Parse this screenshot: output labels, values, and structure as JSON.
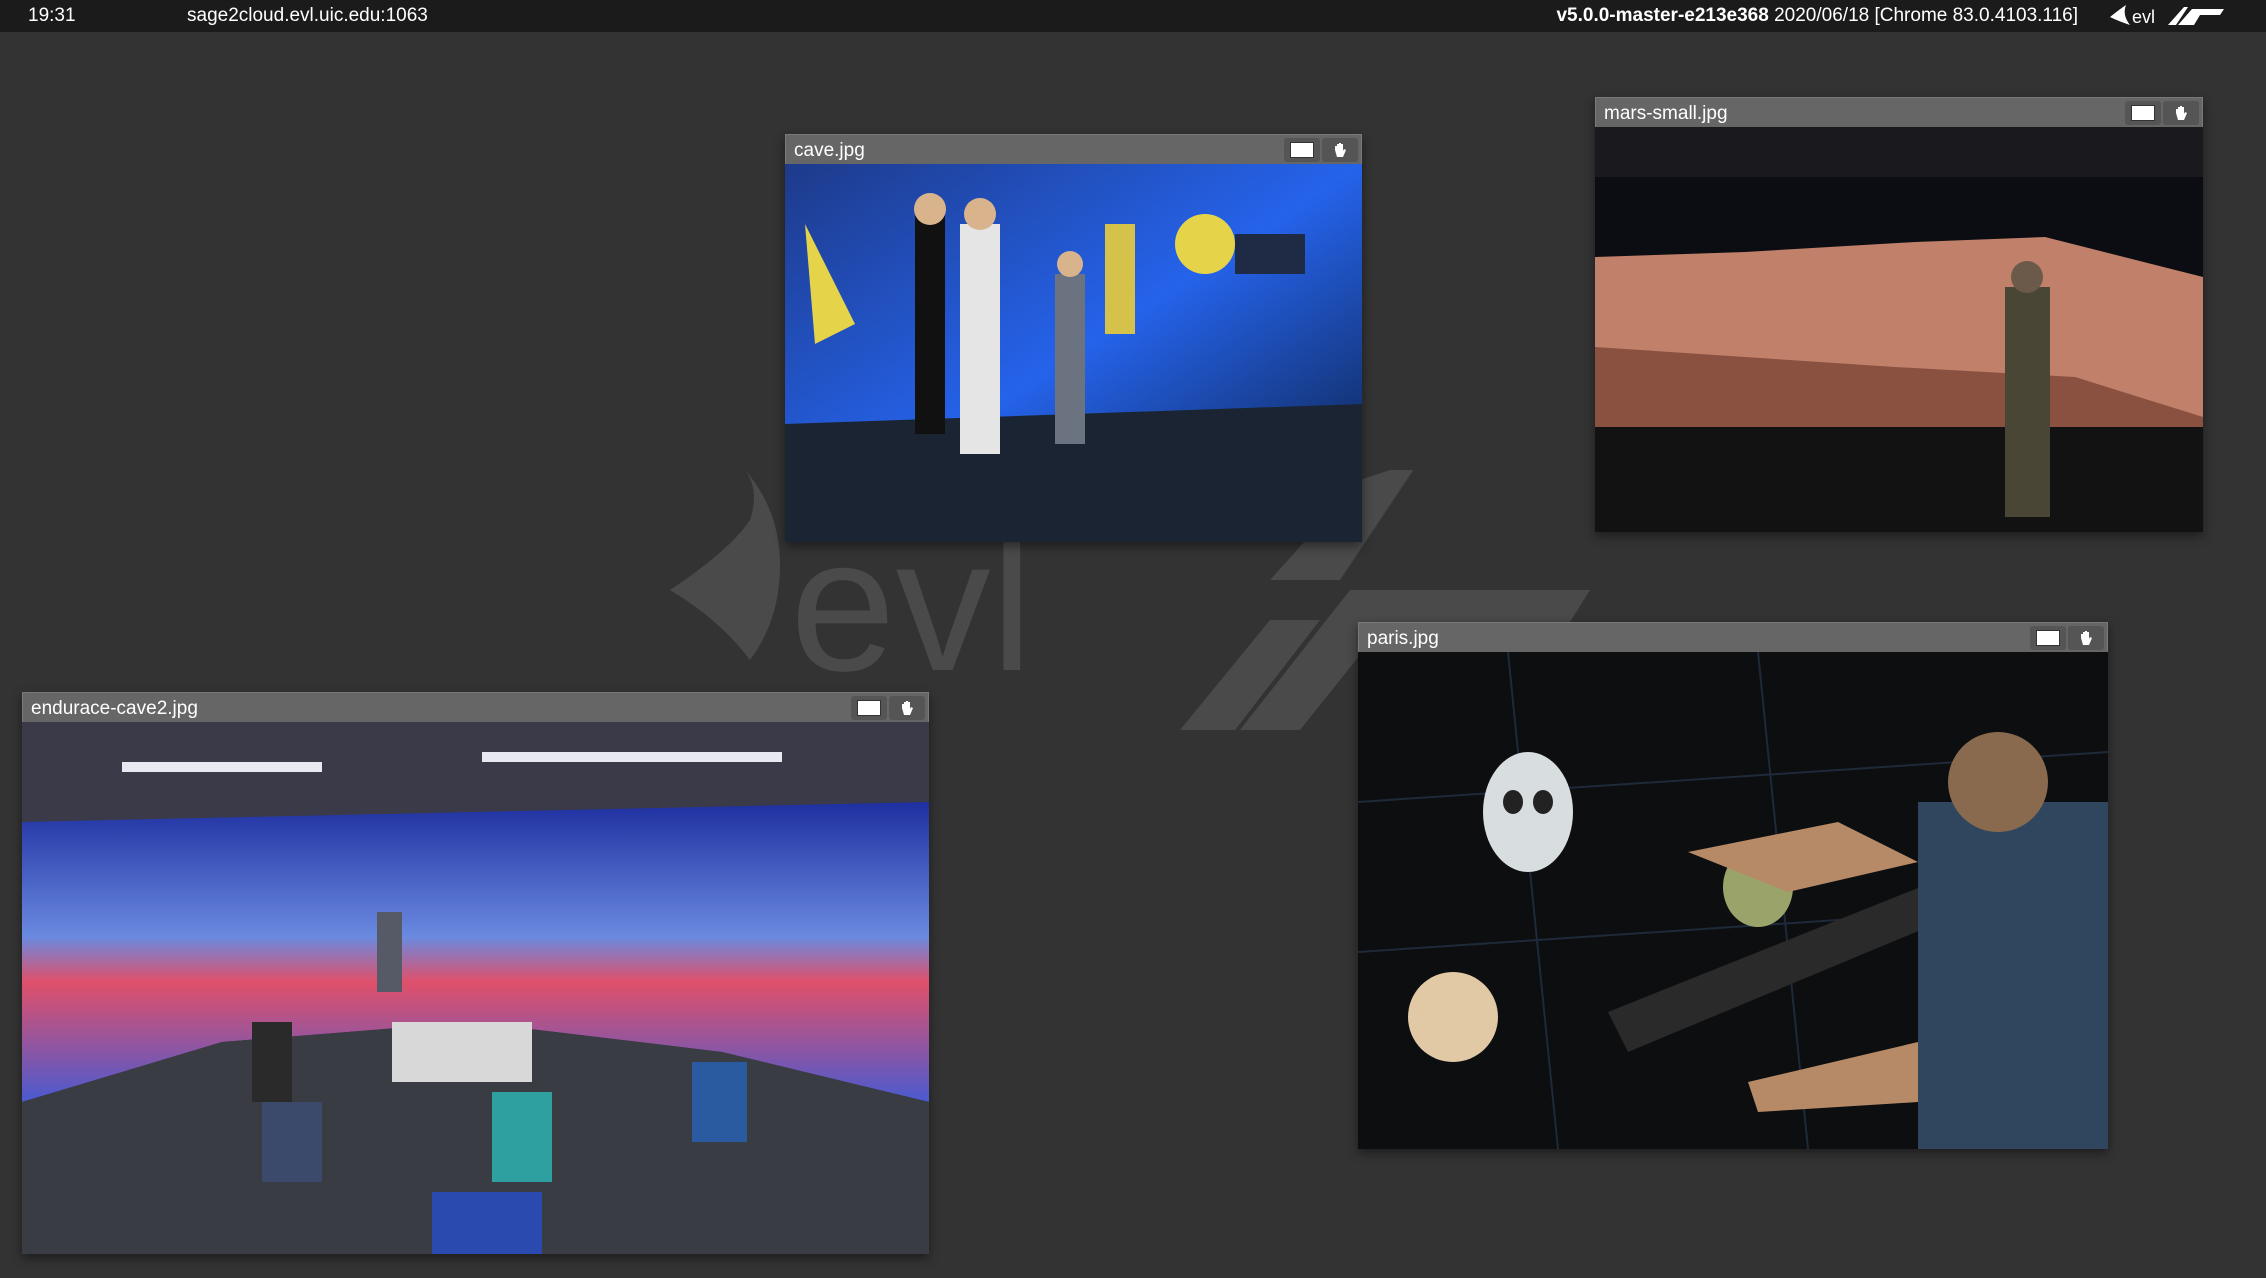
{
  "topbar": {
    "clock": "19:31",
    "host": "sage2cloud.evl.uic.edu:1063",
    "version_bold": "v5.0.0-master-e213e368",
    "version_rest": " 2020/06/18 [Chrome 83.0.4103.116]",
    "logo_icon": "evl-logo-icon"
  },
  "watermark": {
    "text": "evl",
    "icon": "evl-watermark-icon"
  },
  "windows": {
    "cave": {
      "title": "cave.jpg"
    },
    "mars": {
      "title": "mars-small.jpg"
    },
    "paris": {
      "title": "paris.jpg"
    },
    "endurance": {
      "title": "endurace-cave2.jpg"
    }
  },
  "buttons": {
    "fullscreen_icon": "fullscreen-icon",
    "close_icon": "hand-close-icon"
  }
}
